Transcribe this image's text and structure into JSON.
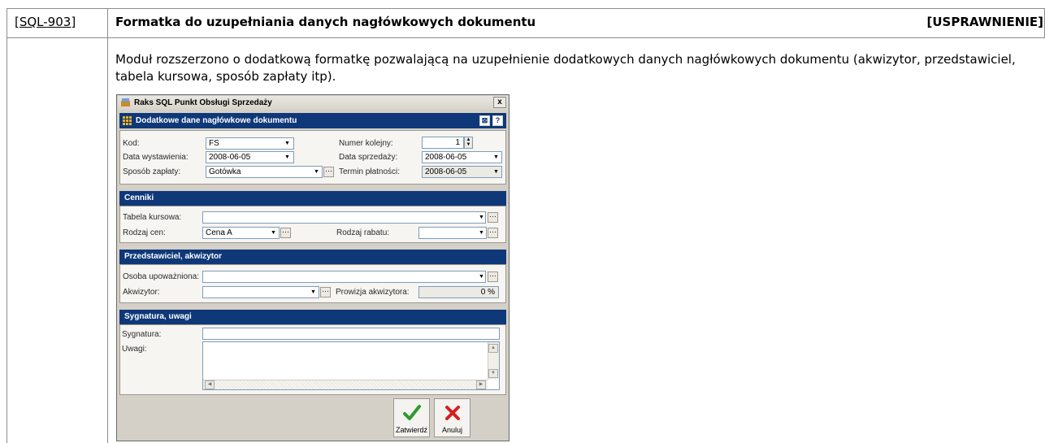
{
  "doc": {
    "issue_id": "[SQL-903]",
    "title": "Formatka do uzupełniania danych nagłówkowych dokumentu",
    "type": "[USPRAWNIENIE]",
    "description": "Moduł rozszerzono o dodatkową formatkę pozwalającą na uzupełnienie dodatkowych danych nagłówkowych dokumentu (akwizytor, przedstawiciel, tabela kursowa, sposób zapłaty itp)."
  },
  "window": {
    "title": "Raks SQL Punkt Obsługi Sprzedaży",
    "close": "x",
    "header": "Dodatkowe dane nagłówkowe dokumentu",
    "header_btn_1": "⊠",
    "header_btn_2": "?"
  },
  "basic": {
    "kod_label": "Kod:",
    "kod_value": "FS",
    "data_wyst_label": "Data wystawienia:",
    "data_wyst_value": "2008-06-05",
    "sposob_label": "Sposób zapłaty:",
    "sposob_value": "Gotówka",
    "numer_label": "Numer kolejny:",
    "numer_value": "1",
    "data_sprz_label": "Data sprzedaży:",
    "data_sprz_value": "2008-06-05",
    "termin_label": "Termin płatności:",
    "termin_value": "2008-06-05"
  },
  "cenniki": {
    "title": "Cenniki",
    "tabela_label": "Tabela kursowa:",
    "tabela_value": "",
    "rodzaj_cen_label": "Rodzaj cen:",
    "rodzaj_cen_value": "Cena A",
    "rodzaj_rabatu_label": "Rodzaj rabatu:",
    "rodzaj_rabatu_value": ""
  },
  "przedstawiciel": {
    "title": "Przedstawiciel, akwizytor",
    "osoba_label": "Osoba upoważniona:",
    "osoba_value": "",
    "akwizytor_label": "Akwizytor:",
    "akwizytor_value": "",
    "prowizja_label": "Prowizja akwizytora:",
    "prowizja_value": "0 %"
  },
  "sygnatura": {
    "title": "Sygnatura, uwagi",
    "sygnatura_label": "Sygnatura:",
    "sygnatura_value": "",
    "uwagi_label": "Uwagi:",
    "uwagi_value": ""
  },
  "buttons": {
    "confirm": "Zatwierdź",
    "cancel": "Anuluj"
  },
  "colors": {
    "header_bar": "#0f3879",
    "confirm_icon": "#2e9a2e",
    "cancel_icon": "#d42020"
  }
}
